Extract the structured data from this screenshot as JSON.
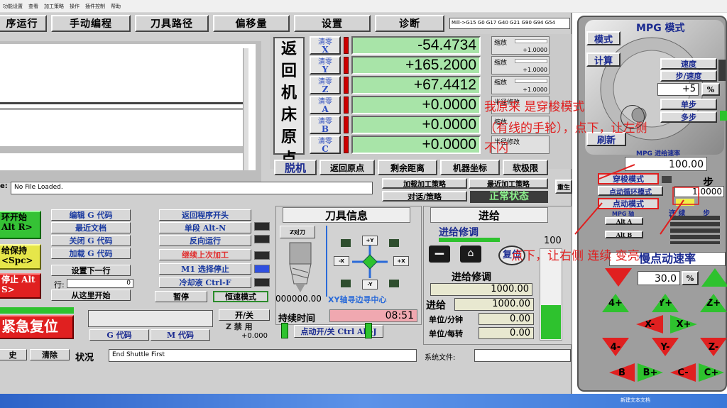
{
  "menu": [
    "功能设置",
    "查看",
    "加工策略",
    "操作",
    "插件控制",
    "帮助"
  ],
  "tabs": [
    "序运行",
    "手动编程",
    "刀具路径",
    "偏移量",
    "设置",
    "诊断"
  ],
  "gcode_status": "Mill->G15  G0 G17 G40 G21 G90 G94 G54",
  "dro_title": [
    "返",
    "回",
    "机",
    "床",
    "原",
    "点"
  ],
  "dro": [
    {
      "btn1": "清零",
      "btn2": "X",
      "value": "-54.4734",
      "scale_label": "缩放",
      "scale": "+1.0000"
    },
    {
      "btn1": "清零",
      "btn2": "Y",
      "value": "+165.2000",
      "scale_label": "缩放",
      "scale": "+1.0000"
    },
    {
      "btn1": "清零",
      "btn2": "Z",
      "value": "+67.4412",
      "scale_label": "缩放",
      "scale": "+1.0000"
    },
    {
      "btn1": "清零",
      "btn2": "A",
      "value": "+0.0000",
      "scale_label": "半径修改",
      "scale": ""
    },
    {
      "btn1": "清零",
      "btn2": "B",
      "value": "+0.0000",
      "scale_label": "缩放",
      "scale": ""
    },
    {
      "btn1": "清零",
      "btn2": "C",
      "value": "+0.0000",
      "scale_label": "半径修改",
      "scale": ""
    }
  ],
  "dro_buttons": [
    "脱机",
    "返回原点",
    "剩余距离",
    "机器坐标",
    "软极限"
  ],
  "file_label": "e:",
  "file_value": "No File Loaded.",
  "load_strategy": "加载加工策略",
  "recent_strategy": "最近加工策略",
  "dialog_strategy": "对话/策略",
  "status_state": "正常状态",
  "regen": "重生",
  "run_col1": [
    "编辑 G 代码",
    "最近文档",
    "关闭 G 代码",
    "加载 G 代码",
    "设置下一行",
    "从这里开始"
  ],
  "run_col2": [
    "返回程序开头",
    "单段 Alt-N",
    "反向运行",
    "继续上次加工",
    "M1 选择停止",
    "冷却液 Ctrl-F"
  ],
  "line_label": "行:",
  "line_value": "0",
  "cycle_start": "环开始 Alt R>",
  "feed_hold": "给保持 <Spc>",
  "stop": "停止 Alt S>",
  "estop": "紧急复位",
  "pause": "暂停",
  "const_speed": "恒速模式",
  "on_off": "开/关",
  "z_disable": "Z 禁 用",
  "z_value": "+0.000",
  "gcode_btn": "G 代码",
  "mcode_btn": "M 代码",
  "history": "史",
  "clear": "清除",
  "status_label": "状况",
  "status_text": "End Shuttle First",
  "sysfile_label": "系统文件:",
  "tool_title": "刀具信息",
  "z_tool": "Z对刀",
  "tool_value": "000000.00",
  "edge_finder": "XY轴寻边寻中心",
  "jog_labels": [
    "+Y",
    "-X",
    "+X",
    "-Y"
  ],
  "elapsed_label": "持续时间",
  "elapsed_value": "08:51",
  "jog_toggle": "点动开/关 Ctrl Alt-J",
  "feed_title": "进给",
  "feed_override": "进给修调",
  "feed_override2": "进给修调",
  "reset": "复位",
  "feed_pct": "100",
  "feed_override_value": "1000.00",
  "feed_label": "进给",
  "feed_value": "1000.00",
  "unit_min": "单位/分钟",
  "unit_min_value": "0.00",
  "unit_rev": "单位/每转",
  "unit_rev_value": "0.00",
  "mpg": {
    "title": "MPG 模式",
    "mode": "模式",
    "calc": "计算",
    "speed": "速度",
    "step_speed": "步/速度",
    "step_value": "+5",
    "pct": "%",
    "single": "单步",
    "multi": "多步",
    "refresh": "刷新",
    "rate_label": "MPG 进给速率",
    "rate": "100.00",
    "shuttle": "穿梭模式",
    "jog_cycle": "点动循环模式",
    "jog_mode": "点动模式",
    "step_label": "步",
    "step": "1.0000",
    "mpg_axis": "MPG 轴",
    "alt_a": "Alt A",
    "alt_b": "Alt B",
    "cont": "连 续",
    "step2": "步",
    "jog_rate": "慢点动速率",
    "jog_rate_value": "30.0",
    "jog_pct": "%"
  },
  "mpg_arrows": [
    "",
    "",
    "4+",
    "Y+",
    "Z+",
    "X-",
    "X+",
    "4-",
    "Y-",
    "Z-",
    "B",
    "B+",
    "C-",
    "C+"
  ],
  "annotation1_lines": [
    "我原来 是穿梭模式",
    "（有线的手轮），点下，让左侧",
    "不闪"
  ],
  "annotation2": "点下，让右侧 连续 变亮",
  "taskbar_text": "新建文本文档"
}
